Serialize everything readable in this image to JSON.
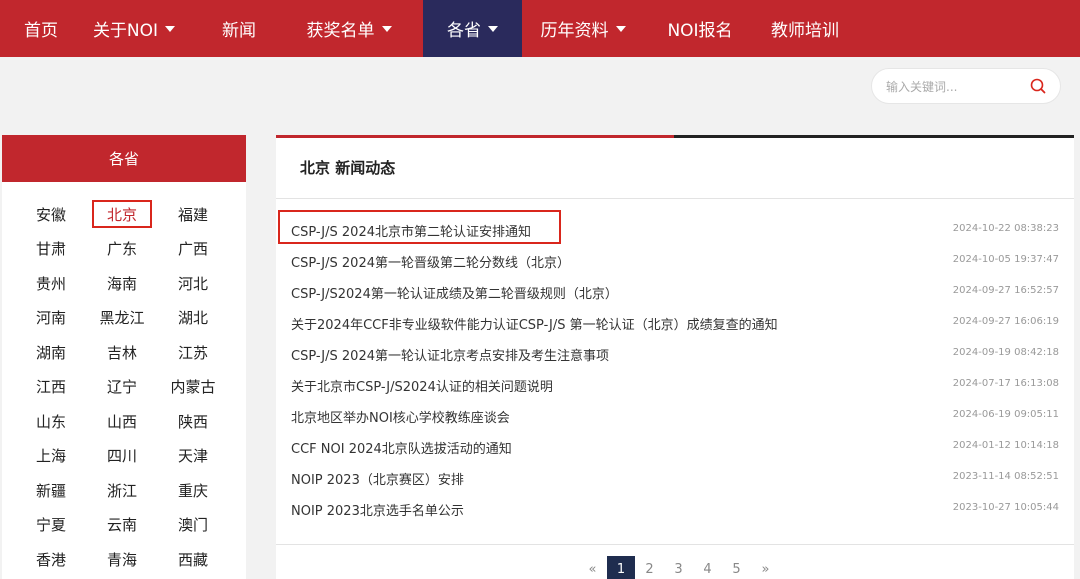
{
  "nav": {
    "items": [
      {
        "label": "首页",
        "dropdown": false,
        "active": false
      },
      {
        "label": "关于NOI",
        "dropdown": true,
        "active": false
      },
      {
        "label": "新闻",
        "dropdown": false,
        "active": false
      },
      {
        "label": "获奖名单",
        "dropdown": true,
        "active": false
      },
      {
        "label": "各省",
        "dropdown": true,
        "active": true
      },
      {
        "label": "历年资料",
        "dropdown": true,
        "active": false
      },
      {
        "label": "NOI报名",
        "dropdown": false,
        "active": false
      },
      {
        "label": "教师培训",
        "dropdown": false,
        "active": false
      }
    ]
  },
  "search": {
    "placeholder": "输入关键词...",
    "icon": "search-icon"
  },
  "sidebar": {
    "title": "各省",
    "provinces": [
      [
        "安徽",
        "北京",
        "福建"
      ],
      [
        "甘肃",
        "广东",
        "广西"
      ],
      [
        "贵州",
        "海南",
        "河北"
      ],
      [
        "河南",
        "黑龙江",
        "湖北"
      ],
      [
        "湖南",
        "吉林",
        "江苏"
      ],
      [
        "江西",
        "辽宁",
        "内蒙古"
      ],
      [
        "山东",
        "山西",
        "陕西"
      ],
      [
        "上海",
        "四川",
        "天津"
      ],
      [
        "新疆",
        "浙江",
        "重庆"
      ],
      [
        "宁夏",
        "云南",
        "澳门"
      ],
      [
        "香港",
        "青海",
        "西藏"
      ]
    ],
    "selected": "北京"
  },
  "main": {
    "title": "北京 新闻动态",
    "news": [
      {
        "title": "CSP-J/S 2024北京市第二轮认证安排通知",
        "date": "2024-10-22 08:38:23"
      },
      {
        "title": "CSP-J/S 2024第一轮晋级第二轮分数线（北京）",
        "date": "2024-10-05 19:37:47"
      },
      {
        "title": "CSP-J/S2024第一轮认证成绩及第二轮晋级规则（北京）",
        "date": "2024-09-27 16:52:57"
      },
      {
        "title": "关于2024年CCF非专业级软件能力认证CSP-J/S 第一轮认证（北京）成绩复查的通知",
        "date": "2024-09-27 16:06:19"
      },
      {
        "title": "CSP-J/S 2024第一轮认证北京考点安排及考生注意事项",
        "date": "2024-09-19 08:42:18"
      },
      {
        "title": "关于北京市CSP-J/S2024认证的相关问题说明",
        "date": "2024-07-17 16:13:08"
      },
      {
        "title": "北京地区举办NOI核心学校教练座谈会",
        "date": "2024-06-19 09:05:11"
      },
      {
        "title": "CCF NOI 2024北京队选拔活动的通知",
        "date": "2024-01-12 10:14:18"
      },
      {
        "title": "NOIP 2023（北京赛区）安排",
        "date": "2023-11-14 08:52:51"
      },
      {
        "title": "NOIP 2023北京选手名单公示",
        "date": "2023-10-27 10:05:44"
      }
    ]
  },
  "pagination": {
    "prev": "«",
    "pages": [
      "1",
      "2",
      "3",
      "4",
      "5"
    ],
    "current": "1",
    "next": "»"
  },
  "colors": {
    "brand_red": "#c1272d",
    "active_nav": "#2a2a5c",
    "highlight": "#d9261c"
  }
}
